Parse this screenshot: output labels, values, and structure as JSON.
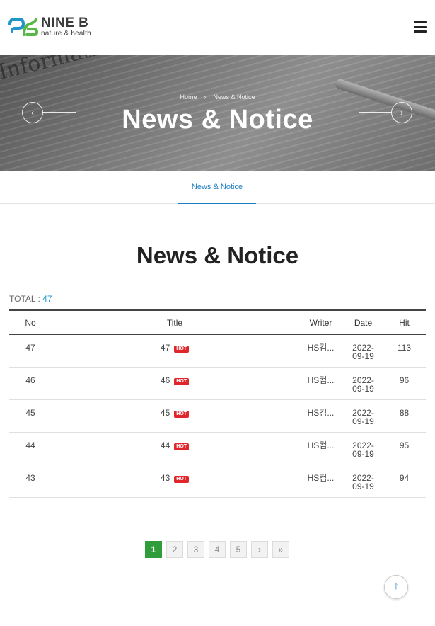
{
  "header": {
    "logo_name": "NINE B",
    "logo_sub": "nature & health"
  },
  "hero": {
    "background_word": "Informationen",
    "breadcrumb_home": "Home",
    "breadcrumb_current": "News & Notice",
    "title": "News & Notice"
  },
  "subtab": {
    "label": "News & Notice"
  },
  "section": {
    "title": "News & Notice"
  },
  "total": {
    "label": "TOTAL :",
    "count": "47"
  },
  "table": {
    "headers": {
      "no": "No",
      "title": "Title",
      "writer": "Writer",
      "date": "Date",
      "hit": "Hit"
    },
    "hot_label": "HOT",
    "rows": [
      {
        "no": "47",
        "title": "47",
        "writer": "HS컴...",
        "date_1": "2022-",
        "date_2": "09-19",
        "hit": "113"
      },
      {
        "no": "46",
        "title": "46",
        "writer": "HS컴...",
        "date_1": "2022-",
        "date_2": "09-19",
        "hit": "96"
      },
      {
        "no": "45",
        "title": "45",
        "writer": "HS컴...",
        "date_1": "2022-",
        "date_2": "09-19",
        "hit": "88"
      },
      {
        "no": "44",
        "title": "44",
        "writer": "HS컴...",
        "date_1": "2022-",
        "date_2": "09-19",
        "hit": "95"
      },
      {
        "no": "43",
        "title": "43",
        "writer": "HS컴...",
        "date_1": "2022-",
        "date_2": "09-19",
        "hit": "94"
      }
    ]
  },
  "pagination": {
    "pages": [
      "1",
      "2",
      "3",
      "4",
      "5"
    ],
    "current": "1",
    "next_icon": "›",
    "last_icon": "»"
  },
  "top_button": {
    "icon": "↑"
  },
  "colors": {
    "accent": "#1c7ec4",
    "pager_active": "#2e9d3a",
    "hot_badge": "#e0262b",
    "total_count": "#1c9ad6"
  }
}
